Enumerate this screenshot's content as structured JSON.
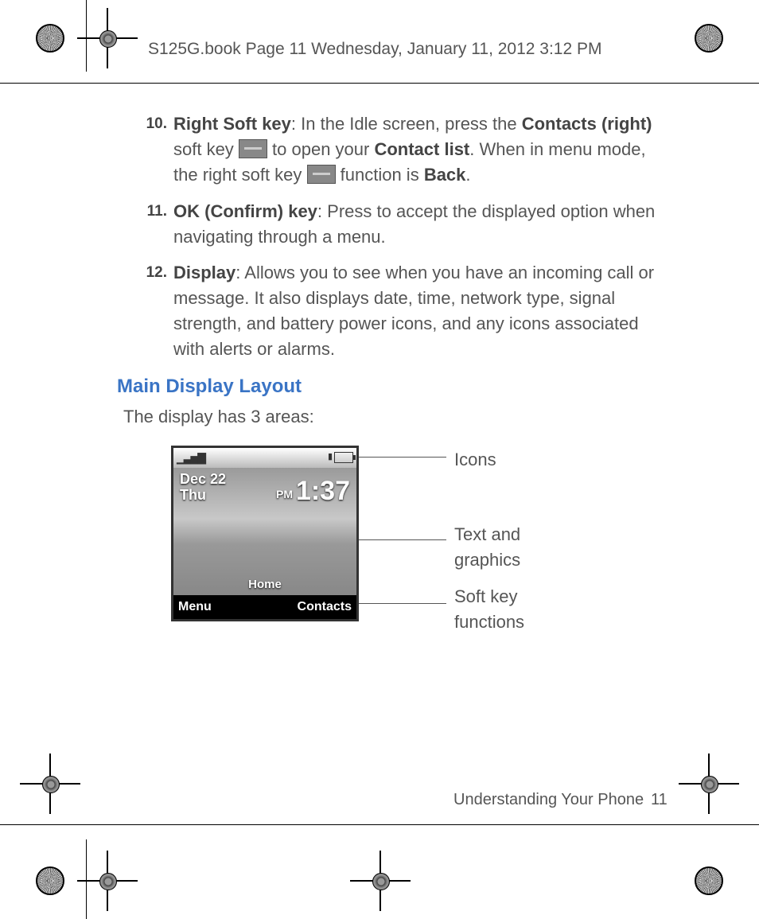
{
  "header": {
    "slug": "S125G.book  Page 11  Wednesday, January 11, 2012  3:12 PM"
  },
  "list": {
    "item10": {
      "num": "10.",
      "label": "Right Soft key",
      "bold1": "Contacts (right)",
      "bold2": "Contact list",
      "bold3": "Back",
      "t1": ": In the Idle screen, press the ",
      "t2": " soft key ",
      "t3": " to open your ",
      "t4": ". When in menu mode, the right soft key ",
      "t5": " function is ",
      "t6": "."
    },
    "item11": {
      "num": "11.",
      "label": "OK (Confirm) key",
      "text": ": Press to accept the displayed option when navigating through a menu."
    },
    "item12": {
      "num": "12.",
      "label": "Display",
      "text": ": Allows you to see when you have an incoming call or message. It also displays date, time, network type, signal strength, and battery power icons, and any icons associated with alerts or alarms."
    }
  },
  "section": {
    "title": "Main Display Layout",
    "intro": "The display has 3 areas:"
  },
  "diagram": {
    "date_line1": "Dec 22",
    "date_line2": "Thu",
    "pm": "PM",
    "time": "1:37",
    "soft_left": "Menu",
    "soft_center": "Home",
    "soft_right": "Contacts",
    "call1": "Icons",
    "call2a": "Text and",
    "call2b": "graphics",
    "call3a": "Soft key",
    "call3b": "functions"
  },
  "footer": {
    "section": "Understanding Your Phone",
    "page": "11"
  }
}
